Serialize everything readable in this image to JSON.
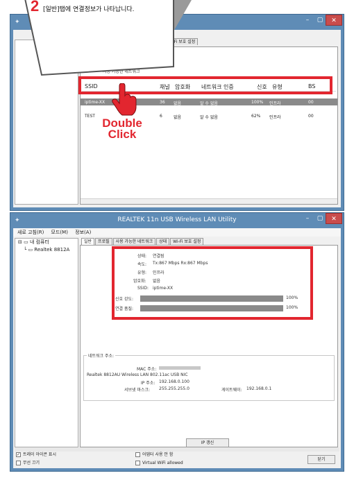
{
  "callout": {
    "number": "2",
    "text": "[일반]탭에 연결정보가 나타납니다."
  },
  "hand": {
    "label": "Double\nClick"
  },
  "window1": {
    "tabs": [
      "상태",
      "Wi-Fi 보호 설정"
    ],
    "group_title": "사용 가능한 네트워크",
    "columns": [
      "SSID",
      "채널",
      "암호화",
      "네트워크 인증",
      "신호",
      "유형",
      "BS"
    ],
    "rows": [
      {
        "ssid": "iptime-XX",
        "channel": "36",
        "enc": "없음",
        "auth": "알 수 없음",
        "signal": "100%",
        "type": "인프라",
        "bs": "00"
      },
      {
        "ssid": "TEST",
        "channel": "6",
        "enc": "없음",
        "auth": "알 수 없음",
        "signal": "62%",
        "type": "인프라",
        "bs": "00"
      }
    ]
  },
  "window2": {
    "title": "REALTEK 11n USB Wireless LAN Utility",
    "menu": [
      "새로 고침(R)",
      "모드(M)",
      "정보(A)"
    ],
    "tree": [
      "내 컴퓨터",
      "Realtek 8812A"
    ],
    "tabs": [
      "일반",
      "프로필",
      "사용 가능한 네트워크",
      "상태",
      "Wi-Fi 보호 설정"
    ],
    "status": {
      "state_label": "상태:",
      "state": "연결됨",
      "speed_label": "속도:",
      "speed": "Tx:867 Mbps Rx:867 Mbps",
      "type_label": "유형:",
      "type": "인프라",
      "enc_label": "암호화:",
      "enc": "없음",
      "ssid_label": "SSID:",
      "ssid": "iptime-XX",
      "signal_label": "신호 강도:",
      "signal": "100%",
      "quality_label": "연결 품질:",
      "quality": "100%",
      "signal_level": 1.0,
      "quality_level": 1.0
    },
    "network": {
      "group_title": "네트워크 주소:",
      "mac_label": "MAC 주소:",
      "adapter": "Realtek 8812AU Wireless LAN 802.11ac USB NIC",
      "ip_label": "IP 주소:",
      "ip": "192.168.0.100",
      "subnet_label": "서브넷 마스크:",
      "subnet": "255.255.255.0",
      "gateway_label": "게이트웨이:",
      "gateway": "192.168.0.1"
    },
    "renew_button": "IP 갱신",
    "bottom": {
      "tray_icon": "트레이 아이콘 표시",
      "radio_off": "무선 끄기",
      "disable_adapter": "어댑터 사용 안 함",
      "virtual_wifi": "Virtual WiFi allowed",
      "close": "닫기"
    }
  },
  "colors": {
    "highlight": "#e2262f",
    "titlebar": "#5f8cb6",
    "callout_number": "#e2262f"
  }
}
